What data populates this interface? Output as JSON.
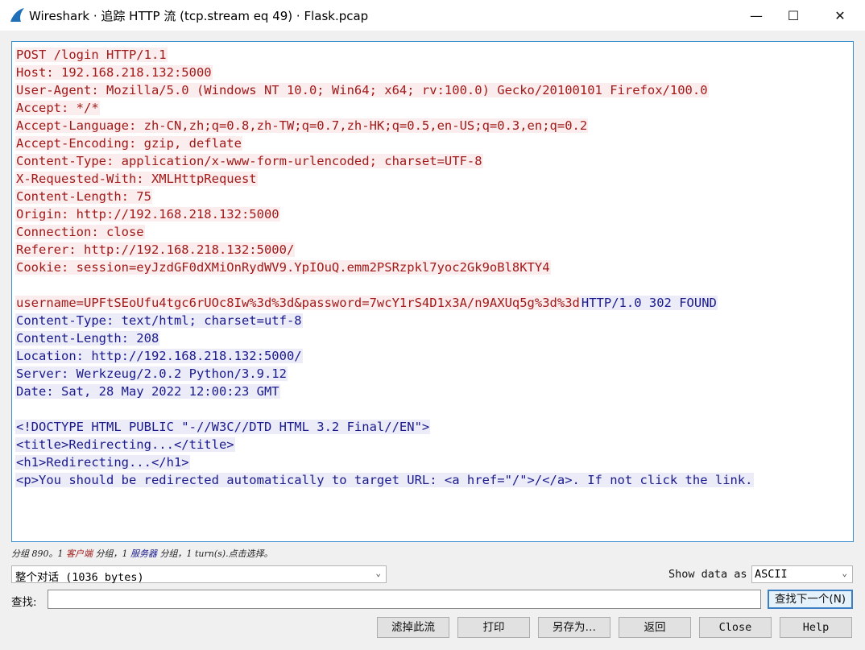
{
  "window": {
    "title": "Wireshark · 追踪 HTTP 流 (tcp.stream eq 49) · Flask.pcap",
    "minimize_glyph": "—",
    "maximize_glyph": "☐",
    "close_glyph": "✕",
    "icon": "wireshark-fin-icon"
  },
  "stream": {
    "lines": [
      {
        "dir": "client",
        "text": "POST /login HTTP/1.1"
      },
      {
        "dir": "client",
        "text": "Host: 192.168.218.132:5000"
      },
      {
        "dir": "client",
        "text": "User-Agent: Mozilla/5.0 (Windows NT 10.0; Win64; x64; rv:100.0) Gecko/20100101 Firefox/100.0"
      },
      {
        "dir": "client",
        "text": "Accept: */*"
      },
      {
        "dir": "client",
        "text": "Accept-Language: zh-CN,zh;q=0.8,zh-TW;q=0.7,zh-HK;q=0.5,en-US;q=0.3,en;q=0.2"
      },
      {
        "dir": "client",
        "text": "Accept-Encoding: gzip, deflate"
      },
      {
        "dir": "client",
        "text": "Content-Type: application/x-www-form-urlencoded; charset=UTF-8"
      },
      {
        "dir": "client",
        "text": "X-Requested-With: XMLHttpRequest"
      },
      {
        "dir": "client",
        "text": "Content-Length: 75"
      },
      {
        "dir": "client",
        "text": "Origin: http://192.168.218.132:5000"
      },
      {
        "dir": "client",
        "text": "Connection: close"
      },
      {
        "dir": "client",
        "text": "Referer: http://192.168.218.132:5000/"
      },
      {
        "dir": "client",
        "text": "Cookie: session=eyJzdGF0dXMiOnRydWV9.YpIOuQ.emm2PSRzpkl7yoc2Gk9oBl8KTY4"
      },
      {
        "dir": "blank",
        "text": ""
      },
      {
        "dir": "mixed",
        "client_text": "username=UPFtSEoUfu4tgc6rUOc8Iw%3d%3d&password=7wcY1rS4D1x3A/n9AXUq5g%3d%3d",
        "server_text": "HTTP/1.0 302 FOUND"
      },
      {
        "dir": "server",
        "text": "Content-Type: text/html; charset=utf-8"
      },
      {
        "dir": "server",
        "text": "Content-Length: 208"
      },
      {
        "dir": "server",
        "text": "Location: http://192.168.218.132:5000/"
      },
      {
        "dir": "server",
        "text": "Server: Werkzeug/2.0.2 Python/3.9.12"
      },
      {
        "dir": "server",
        "text": "Date: Sat, 28 May 2022 12:00:23 GMT"
      },
      {
        "dir": "blank",
        "text": ""
      },
      {
        "dir": "server",
        "text": "<!DOCTYPE HTML PUBLIC \"-//W3C//DTD HTML 3.2 Final//EN\">"
      },
      {
        "dir": "server",
        "text": "<title>Redirecting...</title>"
      },
      {
        "dir": "server",
        "text": "<h1>Redirecting...</h1>"
      },
      {
        "dir": "server",
        "text": "<p>You should be redirected automatically to target URL: <a href=\"/\">/</a>. If not click the link."
      }
    ]
  },
  "status": {
    "prefix": "分组 890。1 ",
    "client_word": "客户端",
    "middle": " 分组，1 ",
    "server_word": "服务器",
    "suffix": " 分组，1 turn(s).点击选择。"
  },
  "conversation_select": {
    "value": "整个对话 (1036 bytes)",
    "arrow": "⌄"
  },
  "show_data": {
    "label": "Show data as",
    "value": "ASCII",
    "arrow": "⌄"
  },
  "find": {
    "label": "查找:",
    "value": "",
    "next_button": "查找下一个(N)"
  },
  "buttons": {
    "filter_out": "滤掉此流",
    "print": "打印",
    "save_as": "另存为…",
    "back": "返回",
    "close": "Close",
    "help": "Help"
  },
  "colors": {
    "client_fg": "#a11a1a",
    "client_bg": "#fbeded",
    "server_fg": "#1a1a8c",
    "server_bg": "#ececf8",
    "accent": "#3b8fcf"
  }
}
